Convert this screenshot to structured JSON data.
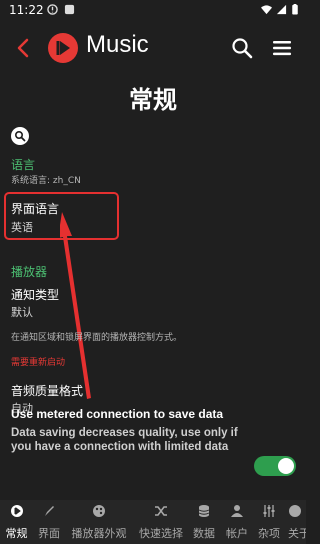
{
  "status_bar": {
    "time": "11:22"
  },
  "app_bar": {
    "title": "Music"
  },
  "page": {
    "title": "常规"
  },
  "language_section": {
    "title": "语言",
    "subtitle": "系统语言: zh_CN"
  },
  "interface_language": {
    "title": "界面语言",
    "value": "英语"
  },
  "player_section": {
    "title": "播放器"
  },
  "notification_type": {
    "title": "通知类型",
    "value": "默认",
    "description": "在通知区域和锁屏界面的播放器控制方式。",
    "warning": "需要重新启动"
  },
  "audio_quality": {
    "title": "音频质量格式",
    "value": "自动"
  },
  "metered": {
    "title": "Use metered connection to save data",
    "description": "Data saving decreases quality, use only if you have a connection with limited data",
    "enabled": true
  },
  "tabs": [
    {
      "label": "常规",
      "icon": "logo-icon",
      "active": true
    },
    {
      "label": "界面",
      "icon": "brush-icon",
      "active": false
    },
    {
      "label": "播放器外观",
      "icon": "palette-icon",
      "active": false
    },
    {
      "label": "快速选择",
      "icon": "shuffle-icon",
      "active": false
    },
    {
      "label": "数据",
      "icon": "database-icon",
      "active": false
    },
    {
      "label": "帐户",
      "icon": "person-icon",
      "active": false
    },
    {
      "label": "杂项",
      "icon": "sliders-icon",
      "active": false
    },
    {
      "label": "关于",
      "icon": "info-icon",
      "active": false
    }
  ],
  "colors": {
    "accent_green": "#4cbf72",
    "brand_red": "#e53935",
    "annotation_red": "#e53030",
    "background": "#1f1f1f"
  }
}
